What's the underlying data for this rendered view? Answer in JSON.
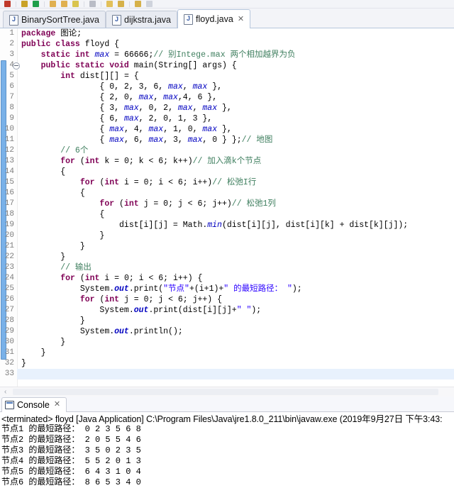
{
  "toolbar": {
    "icons": [
      {
        "name": "stop-icon",
        "color": "#c0392b"
      },
      {
        "name": "save-icon",
        "color": "#c9a227"
      },
      {
        "name": "run-icon",
        "color": "#1e9e4a"
      },
      {
        "name": "open-folder-icon",
        "color": "#e0b050"
      },
      {
        "name": "folder-icon",
        "color": "#e0b050"
      },
      {
        "name": "search-icon",
        "color": "#d9c44e"
      },
      {
        "name": "debug-icon",
        "color": "#b9bcc6"
      },
      {
        "name": "new-java-icon",
        "color": "#e2c05a"
      },
      {
        "name": "back-icon",
        "color": "#d6b14a"
      },
      {
        "name": "forward-icon",
        "color": "#d6b14a"
      },
      {
        "name": "more-icon",
        "color": "#cfd3dc"
      }
    ]
  },
  "editor_tabs": [
    {
      "label": "BinarySortTree.java",
      "active": false,
      "icon": "java-file-icon"
    },
    {
      "label": "dijkstra.java",
      "active": false,
      "icon": "java-file-icon"
    },
    {
      "label": "floyd.java",
      "active": true,
      "icon": "java-file-icon",
      "close": "✕"
    }
  ],
  "code": {
    "annotation_bar_from_line": 4,
    "annotation_bar_to_line": 31,
    "current_line": 33,
    "fold_marker_line": 4,
    "lines": [
      {
        "n": 1,
        "html": "<span class=\"kw\">package</span> 图论;"
      },
      {
        "n": 2,
        "html": "<span class=\"kw\">public class</span> floyd {"
      },
      {
        "n": 3,
        "html": "    <span class=\"kw\">static int</span> <span class=\"fld\">max</span> = 66666;<span class=\"cmt\">// 别Intege.max 两个相加越界为负</span>"
      },
      {
        "n": 4,
        "html": "    <span class=\"kw\">public static void</span> main(String[] args) {"
      },
      {
        "n": 5,
        "html": "        <span class=\"kw\">int</span> dist[][] = {"
      },
      {
        "n": 6,
        "html": "                { 0, 2, 3, 6, <span class=\"fld\">max</span>, <span class=\"fld\">max</span> },"
      },
      {
        "n": 7,
        "html": "                { 2, 0, <span class=\"fld\">max</span>, <span class=\"fld\">max</span>,4, 6 },"
      },
      {
        "n": 8,
        "html": "                { 3, <span class=\"fld\">max</span>, 0, 2, <span class=\"fld\">max</span>, <span class=\"fld\">max</span> },"
      },
      {
        "n": 9,
        "html": "                { 6, <span class=\"fld\">max</span>, 2, 0, 1, 3 },"
      },
      {
        "n": 10,
        "html": "                { <span class=\"fld\">max</span>, 4, <span class=\"fld\">max</span>, 1, 0, <span class=\"fld\">max</span> },"
      },
      {
        "n": 11,
        "html": "                { <span class=\"fld\">max</span>, 6, <span class=\"fld\">max</span>, 3, <span class=\"fld\">max</span>, 0 } };<span class=\"cmt\">// 地图</span>"
      },
      {
        "n": 12,
        "html": "        <span class=\"cmt\">// 6个</span>"
      },
      {
        "n": 13,
        "html": "        <span class=\"kw\">for</span> (<span class=\"kw\">int</span> k = 0; k &lt; 6; k++)<span class=\"cmt\">// 加入滴k个节点</span>"
      },
      {
        "n": 14,
        "html": "        {"
      },
      {
        "n": 15,
        "html": "            <span class=\"kw\">for</span> (<span class=\"kw\">int</span> i = 0; i &lt; 6; i++)<span class=\"cmt\">// 松弛I行</span>"
      },
      {
        "n": 16,
        "html": "            {"
      },
      {
        "n": 17,
        "html": "                <span class=\"kw\">for</span> (<span class=\"kw\">int</span> j = 0; j &lt; 6; j++)<span class=\"cmt\">// 松弛1列</span>"
      },
      {
        "n": 18,
        "html": "                {"
      },
      {
        "n": 19,
        "html": "                    dist[i][j] = Math.<span class=\"fld\">min</span>(dist[i][j], dist[i][k] + dist[k][j]);"
      },
      {
        "n": 20,
        "html": "                }"
      },
      {
        "n": 21,
        "html": "            }"
      },
      {
        "n": 22,
        "html": "        }"
      },
      {
        "n": 23,
        "html": "        <span class=\"cmt\">// 输出</span>"
      },
      {
        "n": 24,
        "html": "        <span class=\"kw\">for</span> (<span class=\"kw\">int</span> i = 0; i &lt; 6; i++) {"
      },
      {
        "n": 25,
        "html": "            System.<span class=\"stat\">out</span>.print(<span class=\"str\">\"节点\"</span>+(i+1)+<span class=\"str\">\" 的最短路径： \"</span>);"
      },
      {
        "n": 26,
        "html": "            <span class=\"kw\">for</span> (<span class=\"kw\">int</span> j = 0; j &lt; 6; j++) {"
      },
      {
        "n": 27,
        "html": "                System.<span class=\"stat\">out</span>.print(dist[i][j]+<span class=\"str\">\" \"</span>);"
      },
      {
        "n": 28,
        "html": "            }"
      },
      {
        "n": 29,
        "html": "            System.<span class=\"stat\">out</span>.println();"
      },
      {
        "n": 30,
        "html": "        }"
      },
      {
        "n": 31,
        "html": "    }"
      },
      {
        "n": 32,
        "html": "}"
      },
      {
        "n": 33,
        "html": ""
      }
    ]
  },
  "console": {
    "tab_label": "Console",
    "tab_close": "✕",
    "terminated_line": "<terminated> floyd [Java Application] C:\\Program Files\\Java\\jre1.8.0_211\\bin\\javaw.exe (2019年9月27日 下午3:43:",
    "output_lines": [
      "节点1 的最短路径： 0 2 3 5 6 8",
      "节点2 的最短路径： 2 0 5 5 4 6",
      "节点3 的最短路径： 3 5 0 2 3 5",
      "节点4 的最短路径： 5 5 2 0 1 3",
      "节点5 的最短路径： 6 4 3 1 0 4",
      "节点6 的最短路径： 8 6 5 3 4 0"
    ]
  },
  "scrollbar": {
    "left_arrow": "‹"
  }
}
